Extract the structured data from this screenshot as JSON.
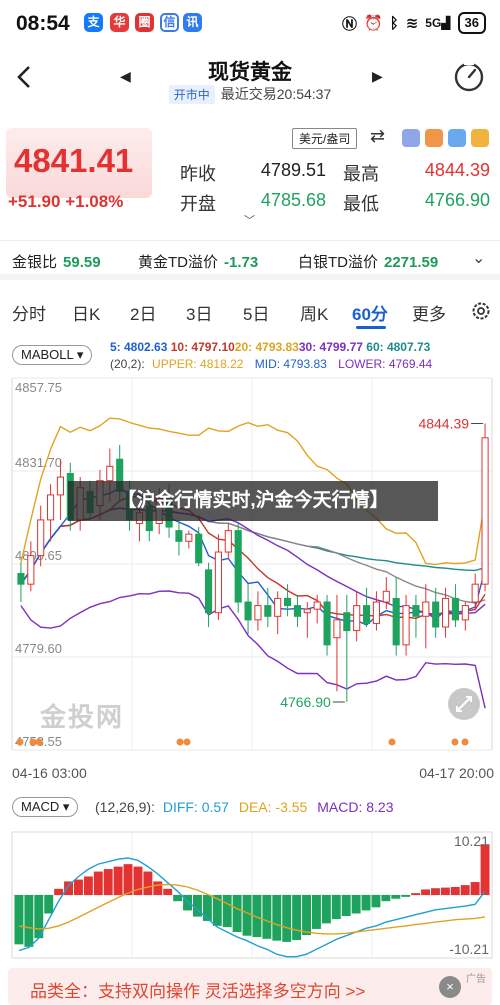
{
  "status": {
    "time": "08:54",
    "battery": "36",
    "signal": "5G",
    "apps": [
      "支",
      "华",
      "圈",
      "信",
      "讯"
    ]
  },
  "header": {
    "title": "现货黄金",
    "market_status": "开市中",
    "last_trade": "最近交易20:54:37"
  },
  "quote": {
    "last_price": "4841.41",
    "change": "+51.90 +1.08%",
    "prev_close_label": "昨收",
    "prev_close": "4789.51",
    "high_label": "最高",
    "high": "4844.39",
    "open_label": "开盘",
    "open": "4785.68",
    "low_label": "最低",
    "low": "4766.90",
    "unit": "美元/盎司"
  },
  "ratios": [
    {
      "label": "金银比",
      "value": "59.59"
    },
    {
      "label": "黄金TD溢价",
      "value": "-1.73"
    },
    {
      "label": "白银TD溢价",
      "value": "2271.59"
    }
  ],
  "tabs": [
    "分时",
    "日K",
    "2日",
    "3日",
    "5日",
    "周K",
    "60分",
    "更多"
  ],
  "active_tab": "60分",
  "ma_legend": {
    "selector": "MABOLL",
    "ma5": "5: 4802.63",
    "ma10": "10: 4797.10",
    "ma20": "20: 4793.83",
    "ma30": "30: 4799.77",
    "ma60": "60: 4807.73",
    "boll_params": "(20,2):",
    "upper": "UPPER: 4818.22",
    "mid": "MID: 4793.83",
    "lower": "LOWER: 4769.44"
  },
  "macd_legend": {
    "selector": "MACD",
    "params": "(12,26,9):",
    "diff": "DIFF: 0.57",
    "dea": "DEA: -3.55",
    "macd": "MACD: 8.23"
  },
  "headline_banner": "【沪金行情实时,沪金今天行情】",
  "watermark": "金投网",
  "ad": {
    "text": "品类全：支持双向操作 灵活选择多空方向 >>",
    "close": "×",
    "tag": "广告"
  },
  "colors": {
    "up": "#e23232",
    "down": "#1ea35f",
    "ma5": "#1e5fd0",
    "ma10": "#c0392b",
    "ma20": "#e0a320",
    "ma30": "#7b2fbf",
    "ma60": "#1e8a8a",
    "accent": "#1e5fd0"
  },
  "chart_data": [
    {
      "type": "candlestick",
      "y_ticks": [
        "4857.75",
        "4831.70",
        "4805.65",
        "4779.60",
        "4753.55"
      ],
      "ylim": [
        4753.55,
        4857.75
      ],
      "x_labels": [
        "04-16 03:00",
        "04-17 20:00"
      ],
      "high_annotation": "4844.39",
      "low_annotation": "4766.90",
      "candles": [
        [
          4803,
          4806,
          4795,
          4800
        ],
        [
          4800,
          4812,
          4798,
          4808
        ],
        [
          4808,
          4822,
          4805,
          4818
        ],
        [
          4818,
          4828,
          4812,
          4825
        ],
        [
          4825,
          4835,
          4818,
          4830
        ],
        [
          4831,
          4834,
          4815,
          4818
        ],
        [
          4818,
          4830,
          4815,
          4827
        ],
        [
          4826,
          4829,
          4818,
          4820
        ],
        [
          4822,
          4832,
          4818,
          4829
        ],
        [
          4829,
          4838,
          4823,
          4833
        ],
        [
          4835,
          4839,
          4823,
          4826
        ],
        [
          4826,
          4829,
          4815,
          4818
        ],
        [
          4817,
          4822,
          4812,
          4820
        ],
        [
          4822,
          4826,
          4812,
          4815
        ],
        [
          4817,
          4827,
          4814,
          4824
        ],
        [
          4824,
          4828,
          4813,
          4816
        ],
        [
          4815,
          4818,
          4808,
          4812
        ],
        [
          4812,
          4815,
          4810,
          4814
        ],
        [
          4814,
          4816,
          4805,
          4806
        ],
        [
          4804,
          4806,
          4788,
          4792
        ],
        [
          4792,
          4814,
          4790,
          4809
        ],
        [
          4809,
          4817,
          4807,
          4815
        ],
        [
          4815,
          4817,
          4792,
          4795
        ],
        [
          4795,
          4800,
          4786,
          4790
        ],
        [
          4790,
          4798,
          4787,
          4794
        ],
        [
          4794,
          4799,
          4788,
          4791
        ],
        [
          4791,
          4798,
          4786,
          4796
        ],
        [
          4796,
          4800,
          4791,
          4794
        ],
        [
          4794,
          4797,
          4788,
          4791
        ],
        [
          4792,
          4795,
          4785,
          4793
        ],
        [
          4793,
          4797,
          4789,
          4795
        ],
        [
          4795,
          4797,
          4780,
          4783
        ],
        [
          4785,
          4797,
          4770,
          4790
        ],
        [
          4792,
          4797,
          4767,
          4787
        ],
        [
          4787,
          4798,
          4784,
          4794
        ],
        [
          4794,
          4799,
          4788,
          4789
        ],
        [
          4789,
          4798,
          4787,
          4795
        ],
        [
          4795,
          4802,
          4793,
          4798
        ],
        [
          4796,
          4802,
          4780,
          4783
        ],
        [
          4783,
          4797,
          4780,
          4794
        ],
        [
          4794,
          4797,
          4785,
          4791
        ],
        [
          4791,
          4800,
          4782,
          4795
        ],
        [
          4795,
          4799,
          4785,
          4788
        ],
        [
          4788,
          4799,
          4785,
          4796
        ],
        [
          4796,
          4800,
          4788,
          4790
        ],
        [
          4790,
          4795,
          4787,
          4794
        ],
        [
          4795,
          4803,
          4793,
          4800
        ],
        [
          4800,
          4845,
          4798,
          4841
        ]
      ]
    },
    {
      "type": "bar",
      "title": "MACD",
      "y_ticks": [
        "10.21",
        "-10.21"
      ],
      "ylim": [
        -10.21,
        10.21
      ],
      "values": [
        -8.0,
        -8.4,
        -7.0,
        -3.0,
        1.0,
        2.2,
        2.5,
        3.0,
        3.8,
        4.2,
        4.6,
        5.0,
        4.6,
        3.8,
        2.2,
        1.0,
        -1.0,
        -2.5,
        -3.5,
        -4.2,
        -5.0,
        -5.2,
        -6.0,
        -6.6,
        -6.8,
        -7.1,
        -7.4,
        -7.6,
        -7.3,
        -6.5,
        -5.5,
        -4.6,
        -3.9,
        -3.4,
        -3.0,
        -2.5,
        -2.0,
        -1.0,
        -0.6,
        -0.3,
        0.3,
        0.9,
        1.1,
        1.2,
        1.3,
        1.6,
        2.1,
        8.23
      ],
      "series": [
        {
          "name": "DIFF",
          "values": [
            -9.0,
            -8.5,
            -7.0,
            -4.0,
            -1.0,
            1.5,
            3.0,
            4.2,
            5.0,
            5.4,
            5.8,
            6.0,
            5.6,
            4.6,
            3.4,
            2.0,
            0.6,
            -1.0,
            -2.4,
            -3.8,
            -5.2,
            -6.0,
            -6.8,
            -7.4,
            -8.2,
            -8.8,
            -9.6,
            -10.0,
            -10.0,
            -9.6,
            -8.8,
            -8.0,
            -7.2,
            -6.6,
            -6.0,
            -5.4,
            -5.0,
            -4.4,
            -4.0,
            -3.6,
            -3.2,
            -2.8,
            -2.4,
            -2.2,
            -2.0,
            -1.8,
            -1.5,
            0.57
          ]
        },
        {
          "name": "DEA",
          "values": [
            -5.0,
            -5.3,
            -5.5,
            -5.4,
            -5.0,
            -4.4,
            -3.6,
            -2.8,
            -2.0,
            -1.2,
            -0.4,
            0.3,
            0.9,
            1.3,
            1.6,
            1.7,
            1.6,
            1.3,
            0.8,
            0.1,
            -0.6,
            -1.4,
            -2.2,
            -2.9,
            -3.6,
            -4.2,
            -4.8,
            -5.3,
            -5.7,
            -6.0,
            -6.2,
            -6.3,
            -6.3,
            -6.2,
            -6.0,
            -5.8,
            -5.6,
            -5.4,
            -5.2,
            -5.0,
            -4.8,
            -4.6,
            -4.4,
            -4.2,
            -4.0,
            -3.9,
            -3.8,
            -3.55
          ]
        }
      ]
    }
  ]
}
